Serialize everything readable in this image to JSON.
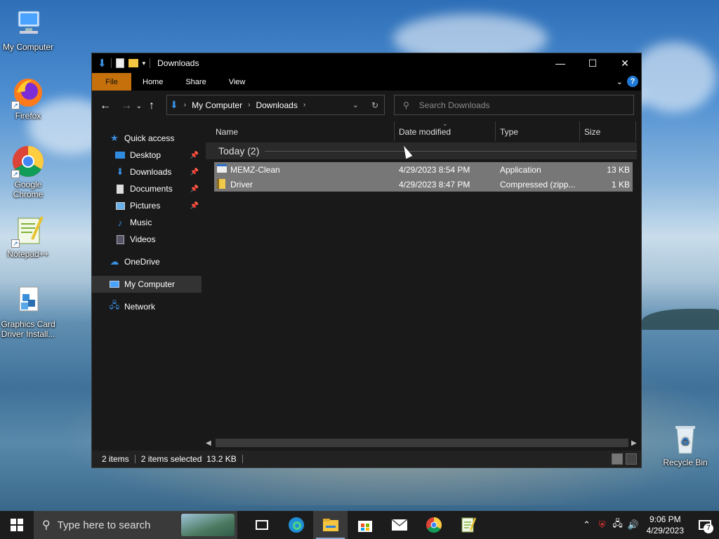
{
  "desktop": {
    "icons": [
      {
        "label": "My Computer"
      },
      {
        "label": "Firefox"
      },
      {
        "label": "Google Chrome"
      },
      {
        "label": "Notepad++"
      },
      {
        "label": "Graphics Card Driver Install..."
      },
      {
        "label": "Recycle Bin"
      }
    ]
  },
  "window": {
    "title": "Downloads",
    "ribbon": {
      "tabs": [
        "File",
        "Home",
        "Share",
        "View"
      ],
      "help_label": "?"
    },
    "address": {
      "crumbs": [
        "My Computer",
        "Downloads"
      ]
    },
    "search": {
      "placeholder": "Search Downloads"
    },
    "navpane": {
      "items": [
        {
          "label": "Quick access",
          "icon": "star-icon"
        },
        {
          "label": "Desktop",
          "icon": "desktop-icon",
          "pinned": true
        },
        {
          "label": "Downloads",
          "icon": "download-icon",
          "pinned": true
        },
        {
          "label": "Documents",
          "icon": "documents-icon",
          "pinned": true
        },
        {
          "label": "Pictures",
          "icon": "pictures-icon",
          "pinned": true
        },
        {
          "label": "Music",
          "icon": "music-icon"
        },
        {
          "label": "Videos",
          "icon": "videos-icon"
        },
        {
          "label": "OneDrive",
          "icon": "cloud-icon"
        },
        {
          "label": "My Computer",
          "icon": "computer-icon",
          "selected": true
        },
        {
          "label": "Network",
          "icon": "network-icon"
        }
      ]
    },
    "columns": [
      "Name",
      "Date modified",
      "Type",
      "Size"
    ],
    "group": {
      "label": "Today (2)"
    },
    "files": [
      {
        "name": "MEMZ-Clean",
        "date": "4/29/2023 8:54 PM",
        "type": "Application",
        "size": "13 KB",
        "icon": "application-icon"
      },
      {
        "name": "Driver",
        "date": "4/29/2023 8:47 PM",
        "type": "Compressed (zipp...",
        "size": "1 KB",
        "icon": "zip-folder-icon"
      }
    ],
    "status": {
      "count": "2 items",
      "selection": "2 items selected  13.2 KB"
    }
  },
  "taskbar": {
    "search_placeholder": "Type here to search",
    "apps": [
      "task-view-icon",
      "edge-icon",
      "file-explorer-icon",
      "store-icon",
      "mail-icon",
      "chrome-icon",
      "notepadpp-icon"
    ],
    "clock": {
      "time": "9:06 PM",
      "date": "4/29/2023"
    },
    "notification_count": "7"
  },
  "colors": {
    "file_tab": "#c5700b",
    "window_bg": "#191919",
    "selected_row": "#777777",
    "accent_blue": "#1e7ad6"
  }
}
